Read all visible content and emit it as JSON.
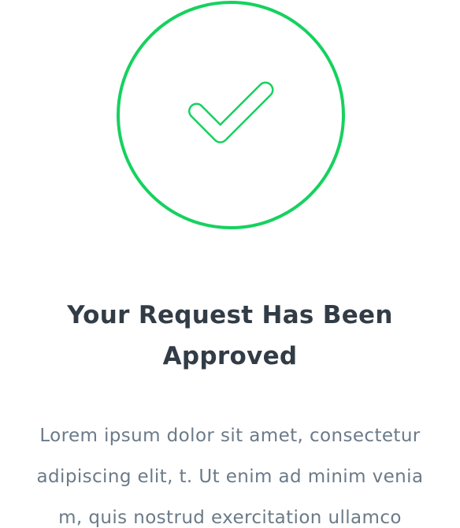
{
  "confirmation": {
    "icon": "check-circle-icon",
    "accent_color": "#16d15f",
    "title_lines": [
      "Your Request Has Been",
      "Approved"
    ],
    "body_lines": [
      "Lorem ipsum dolor sit amet, consectetur",
      "adipiscing elit, t. Ut enim ad minim venia",
      "m, quis nostrud exercitation ullamco"
    ]
  }
}
